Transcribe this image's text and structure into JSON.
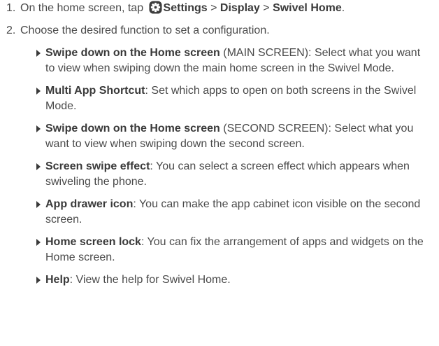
{
  "steps": [
    {
      "number": "1.",
      "text_before": "On the home screen, tap ",
      "icon": "settings-gear-icon",
      "path": [
        {
          "text": "Settings",
          "bold": true
        },
        {
          "text": " > ",
          "bold": false
        },
        {
          "text": "Display",
          "bold": true
        },
        {
          "text": " > ",
          "bold": false
        },
        {
          "text": "Swivel Home",
          "bold": true
        },
        {
          "text": ".",
          "bold": false
        }
      ]
    },
    {
      "number": "2.",
      "text": "Choose the desired function to set a configuration."
    }
  ],
  "bullets": [
    {
      "title": "Swipe down on the Home screen",
      "desc": " (MAIN SCREEN): Select what you want to view when swiping down the main home screen in the Swivel Mode."
    },
    {
      "title": "Multi App Shortcut",
      "desc": ": Set which apps to open on both screens in the Swivel Mode."
    },
    {
      "title": "Swipe down on the Home screen",
      "desc": " (SECOND SCREEN): Select what you want to view when swiping down the second screen."
    },
    {
      "title": "Screen swipe effect",
      "desc": ": You can select a screen effect which appears when swiveling the phone."
    },
    {
      "title": "App drawer icon",
      "desc": ": You can make the app cabinet icon visible on the second screen."
    },
    {
      "title": "Home screen lock",
      "desc": ": You can fix the arrangement of apps and widgets on the Home screen."
    },
    {
      "title": "Help",
      "desc": ": View the help for Swivel Home."
    }
  ],
  "colors": {
    "text": "#4a4a4a",
    "bold_text": "#3a3a3a",
    "icon_bg": "#3c3c3c",
    "bullet_marker": "#3a3a3a"
  }
}
